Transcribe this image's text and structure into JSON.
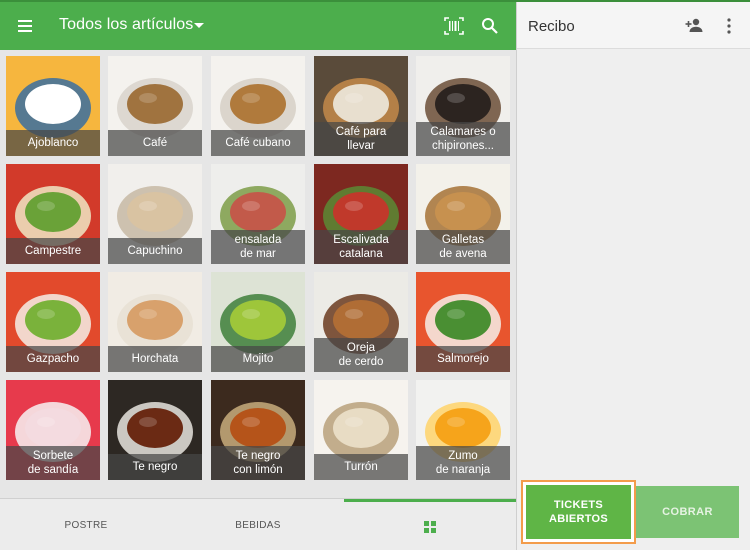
{
  "header": {
    "category_title": "Todos los artículos",
    "icons": [
      "menu-icon",
      "dropdown-caret-icon",
      "barcode-icon",
      "search-icon"
    ],
    "accent": "#4cae4c"
  },
  "items": [
    {
      "label": "Ajoblanco",
      "colors": [
        "#f6b63e",
        "#ffffff",
        "#3a6fa0"
      ]
    },
    {
      "label": "Café",
      "colors": [
        "#f4f2ee",
        "#a0733f",
        "#d8d3cb"
      ]
    },
    {
      "label": "Café cubano",
      "colors": [
        "#f4f2ee",
        "#b07a3c",
        "#d6d0c6"
      ]
    },
    {
      "label": "Café para\nllevar",
      "colors": [
        "#5a4b3a",
        "#e8dfcf",
        "#c48a4a"
      ]
    },
    {
      "label": "Calamares o\nchipirones...",
      "colors": [
        "#f0efec",
        "#2c2420",
        "#6b4d37"
      ]
    },
    {
      "label": "Campestre",
      "colors": [
        "#d23a2a",
        "#6aa238",
        "#f0e7c4"
      ]
    },
    {
      "label": "Capuchino",
      "colors": [
        "#f1efec",
        "#d9c3a2",
        "#c7b8a5"
      ]
    },
    {
      "label": "ensalada\nde mar",
      "colors": [
        "#eeeeec",
        "#c25a4a",
        "#7d9c48"
      ]
    },
    {
      "label": "Escalivada\ncatalana",
      "colors": [
        "#7d2820",
        "#c0392b",
        "#5a8a35"
      ]
    },
    {
      "label": "Galletas\nde avena",
      "colors": [
        "#f3f1ea",
        "#c7914f",
        "#a57236"
      ]
    },
    {
      "label": "Gazpacho",
      "colors": [
        "#e24a2c",
        "#7ab23b",
        "#f5efe8"
      ]
    },
    {
      "label": "Horchata",
      "colors": [
        "#f1ece4",
        "#d8a16c",
        "#e7e1d3"
      ]
    },
    {
      "label": "Mojito",
      "colors": [
        "#dde3d5",
        "#9ec63a",
        "#3e7f3a"
      ]
    },
    {
      "label": "Oreja\nde cerdo",
      "colors": [
        "#ecebe6",
        "#b06d35",
        "#6b3b1e"
      ]
    },
    {
      "label": "Salmorejo",
      "colors": [
        "#e8552e",
        "#4a8f33",
        "#f6efe7"
      ]
    },
    {
      "label": "Sorbete\nde sandía",
      "colors": [
        "#e73a4c",
        "#f4dbe0",
        "#f7f3f3"
      ]
    },
    {
      "label": "Te negro",
      "colors": [
        "#2d2823",
        "#6b2a14",
        "#e8e4de"
      ]
    },
    {
      "label": "Te negro\ncon limón",
      "colors": [
        "#3c2a1e",
        "#b5541a",
        "#c8ad7c"
      ]
    },
    {
      "label": "Turrón",
      "colors": [
        "#f6f3ee",
        "#e8dcc4",
        "#b9a07a"
      ]
    },
    {
      "label": "Zumo\nde naranja",
      "colors": [
        "#f2f2f0",
        "#f6a41b",
        "#ffd46a"
      ]
    }
  ],
  "bottom_tabs": [
    {
      "label": "POSTRE"
    },
    {
      "label": "BEBIDAS"
    },
    {
      "label": "",
      "icon": "grid-icon",
      "active": true
    }
  ],
  "receipt": {
    "title": "Recibo",
    "icons": [
      "add-customer-icon",
      "more-vert-icon"
    ],
    "open_tickets_label": "TICKETS\nABIERTOS",
    "charge_label": "COBRAR",
    "highlight_color": "#f39c4b"
  }
}
